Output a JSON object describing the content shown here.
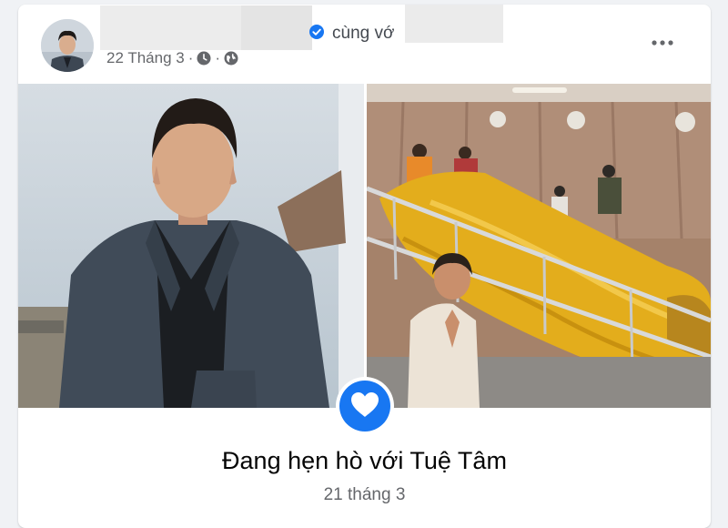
{
  "post": {
    "with_text": "cùng vớ",
    "date": "22 Tháng 3",
    "separator": "·",
    "icons": {
      "verified": "verified-badge-icon",
      "clock": "clock-icon",
      "privacy": "globe-icon",
      "more": "more-options-icon"
    }
  },
  "event": {
    "title": "Đang hẹn hò với Tuệ Tâm",
    "date": "21 tháng 3",
    "icon": "heart-icon"
  },
  "colors": {
    "accent": "#1877f2",
    "text_primary": "#050505",
    "text_secondary": "#65676b",
    "card_bg": "#ffffff",
    "page_bg": "#f0f2f5"
  }
}
